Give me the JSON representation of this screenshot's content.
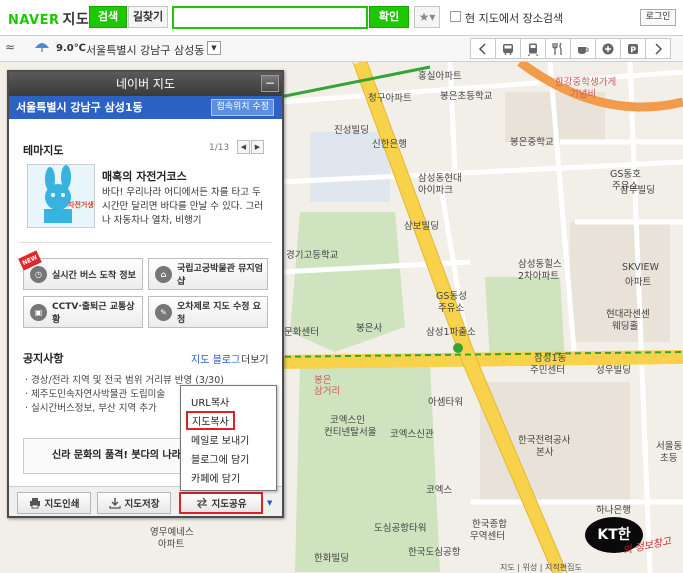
{
  "topbar": {
    "logo": "NAVER",
    "logo_sub": "지도",
    "tab_search": "검색",
    "tab_route": "길찾기",
    "search_value": "",
    "confirm": "확인",
    "fav_icon": "star-icon",
    "current_map_search": "현 지도에서 장소검색",
    "login": "로그인"
  },
  "locbar": {
    "temperature": "9.0℃",
    "location": "서울특별시 강남구 삼성동",
    "categories": [
      "bus-icon",
      "subway-icon",
      "restaurant-icon",
      "cafe-icon",
      "hospital-icon",
      "parking-icon",
      "more-icon"
    ]
  },
  "panel": {
    "title": "네이버 지도",
    "minimize": "−",
    "location": "서울특별시 강남구 삼성1동",
    "location_edit": "접속위치 수정",
    "theme_title": "테마지도",
    "theme_page": "1/13",
    "theme_name": "매혹의 자전거코스",
    "theme_thumb_label": "자전거생활",
    "theme_desc": "바다! 우리나라 어디에서든 차를 타고 두 시간만 달리면 바다를 만날 수 있다. 그러나 자동차나 열차, 비행기",
    "quick_new": "NEW",
    "quick_bus": "실시간 버스 도착 정보",
    "quick_museum": "국립고궁박물관 뮤지엄샵",
    "quick_cctv": "CCTV·출퇴근 교통상황",
    "quick_error": "오차제로 지도 수정 요청",
    "notice_title": "공지사항",
    "notice_blog": "지도 블로그",
    "notice_more": "더보기",
    "notices": [
      "· 경상/전라 지역 및 전국 범위 거리뷰 반영 (3/30)",
      "· 제주도민속자연사박물관 도립미술",
      "· 실시간버스정보, 부산 지역 추가"
    ],
    "banner": "신라 문화의 품격! 붓다의 나라로",
    "print": "지도인쇄",
    "save": "지도저장",
    "share": "지도공유"
  },
  "share_menu": {
    "url_copy": "URL복사",
    "map_copy": "지도복사",
    "email": "메일로 보내기",
    "blog": "블로그에 담기",
    "cafe": "카페에 담기"
  },
  "map_labels": {
    "l1": "홍실아파트",
    "l2": "청구아파트",
    "l3": "봉은초등학교",
    "l4": "한강중학생가게",
    "l4b": "기념비",
    "l5": "봉은중학교",
    "l6": "진성빌딩",
    "l7": "신한은행",
    "l8": "삼성동현대",
    "l8b": "아이파크",
    "l9": "GS동호",
    "l9b": "주유소",
    "l10": "삼부빌딩",
    "l11": "삼보빌딩",
    "l12": "경기고등학교",
    "l13": "삼성동힐스",
    "l13b": "2차아파트",
    "l14": "SKVIEW",
    "l14b": "아파트",
    "l15": "GS동성",
    "l15b": "주유소",
    "l16": "현대라센센",
    "l16b": "웨딩홀",
    "l17": "문화센터",
    "l18": "봉은사",
    "l19": "삼성1파출소",
    "l20": "삼성1동",
    "l20b": "주민센터",
    "l21": "성우빌딩",
    "l22": "봉은",
    "l22b": "삼거리",
    "l23": "아셈타워",
    "l24": "코엑스인",
    "l24b": "컨티넨탈서울",
    "l25": "코엑스신관",
    "l26": "한국전력공사",
    "l26b": "본사",
    "l27": "서울동",
    "l27b": "초등",
    "l28": "코엑스",
    "l29": "하나은행",
    "l30": "도심공항타워",
    "l31": "한국종합",
    "l31b": "무역센터",
    "l32": "영무예네스",
    "l32b": "아파트",
    "l33": "한국도심공항",
    "l34": "한화빌딩"
  },
  "watermark": {
    "text": "KT한",
    "sub": "의 정보창고"
  },
  "bottom_strip": "지도 | 위성 | 지적편집도"
}
